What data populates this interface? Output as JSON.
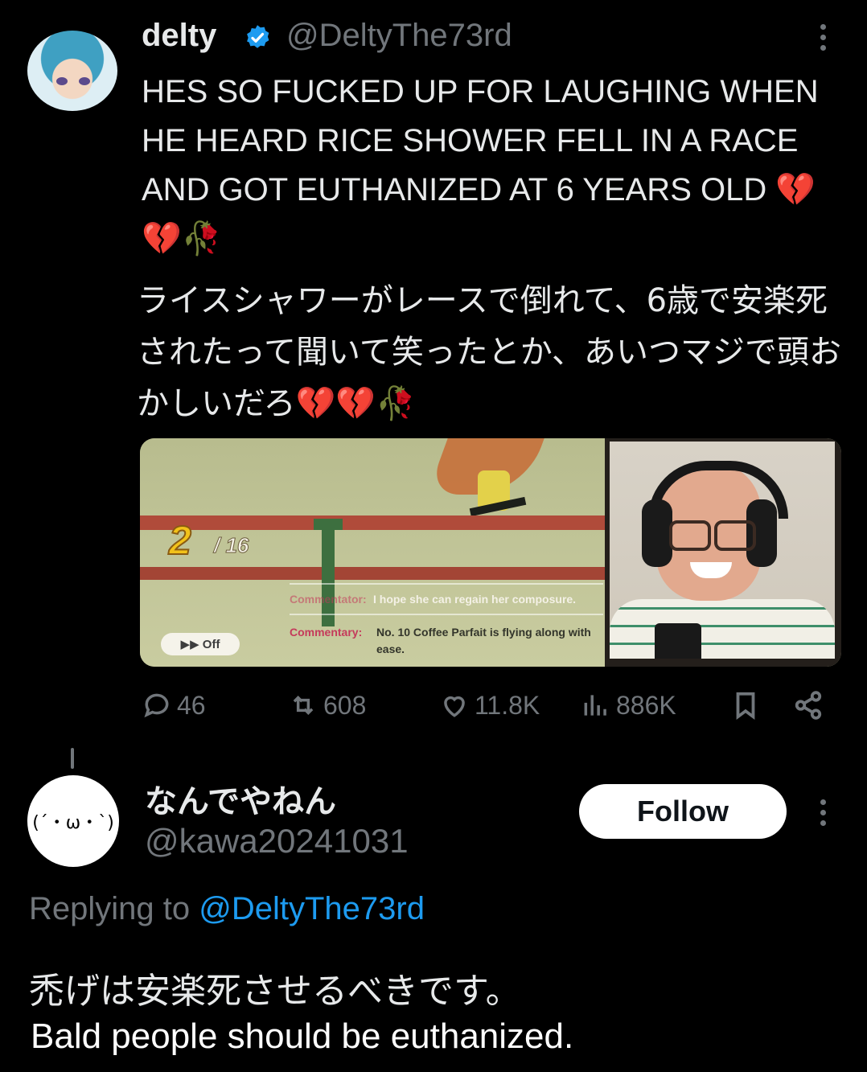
{
  "tweet": {
    "author_name": "delty",
    "author_handle": "@DeltyThe73rd",
    "text_en": "HES SO FUCKED UP FOR LAUGHING WHEN HE HEARD RICE SHOWER FELL IN A RACE AND GOT EUTHANIZED AT 6 YEARS OLD",
    "text_jp": "ライスシャワーがレースで倒れて、6歳で安楽死されたって聞いて笑ったとか、あいつマジで頭おかしいだろ",
    "emoji_tail": "💔💔🥀",
    "media": {
      "rank": "2",
      "rank_of": "/ 16",
      "commentary_label_1": "Commentator:",
      "commentary_text_1": "I hope she can regain her composure.",
      "commentary_label_2": "Commentary:",
      "commentary_text_2": "No. 10 Coffee Parfait is flying along with",
      "commentary_text_2b": "ease.",
      "auto_label": "▶▶ Off"
    },
    "stats": {
      "replies": "46",
      "reposts": "608",
      "likes": "11.8K",
      "views": "886K"
    },
    "icons": [
      "reply-icon",
      "repost-icon",
      "like-icon",
      "views-icon",
      "bookmark-icon",
      "share-icon"
    ],
    "verified_color": "#1d9bf0"
  },
  "reply": {
    "author_name": "なんでやねん",
    "author_handle": "@kawa20241031",
    "avatar_text": "(´・ω・`)",
    "follow_label": "Follow",
    "replying_prefix": "Replying to",
    "replying_handle": "@DeltyThe73rd",
    "text_jp": "禿げは安楽死させるべきです。",
    "text_en": "Bald people should be euthanized."
  },
  "colors": {
    "background": "#000000",
    "muted": "#71767b",
    "link": "#1d9bf0",
    "text": "#e7e9ea"
  }
}
